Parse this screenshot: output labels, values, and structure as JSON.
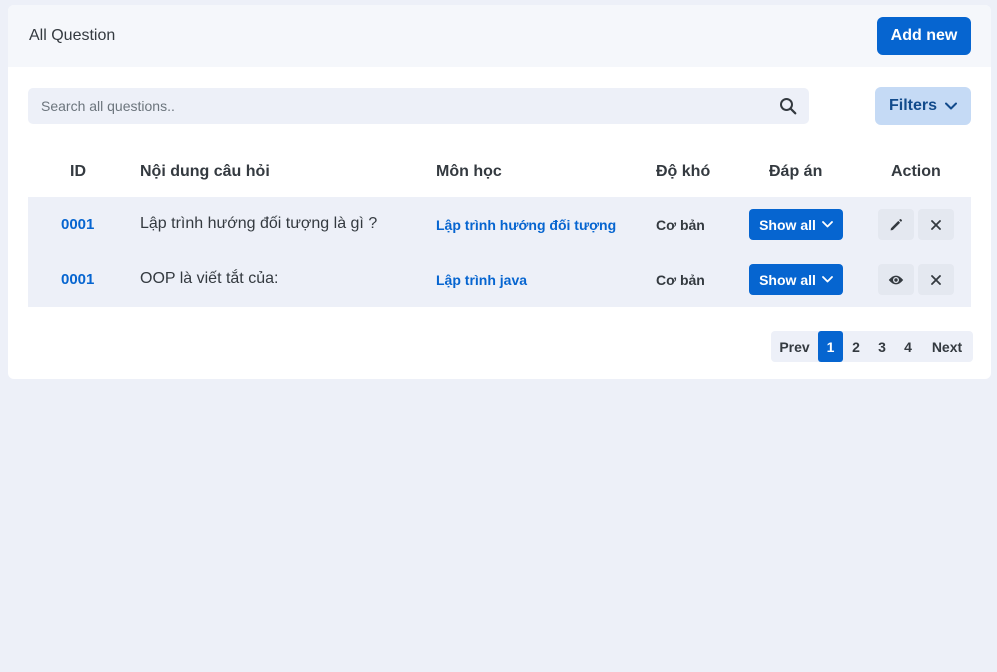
{
  "header": {
    "title": "All Question",
    "add_button": "Add new"
  },
  "search": {
    "placeholder": "Search all questions..",
    "value": ""
  },
  "filters": {
    "label": "Filters"
  },
  "table": {
    "columns": [
      "ID",
      "Nội dung câu hỏi",
      "Môn học",
      "Độ khó",
      "Đáp án",
      "Action"
    ],
    "rows": [
      {
        "id": "0001",
        "content": "Lập trình hướng đối tượng là gì ?",
        "subject": "Lập trình hướng đối tượng",
        "difficulty": "Cơ bản",
        "answer_button": "Show all",
        "action_icons": [
          "pencil-icon",
          "close-icon"
        ]
      },
      {
        "id": "0001",
        "content": "OOP là viết tắt của:",
        "subject": "Lập trình java",
        "difficulty": "Cơ bản",
        "answer_button": "Show all",
        "action_icons": [
          "eye-icon",
          "close-icon"
        ]
      }
    ]
  },
  "pagination": {
    "prev": "Prev",
    "pages": [
      "1",
      "2",
      "3",
      "4"
    ],
    "active_page": "1",
    "next": "Next"
  },
  "colors": {
    "primary": "#0665d0",
    "page_background": "#edf0f8",
    "filters_background": "#c5daf5"
  }
}
